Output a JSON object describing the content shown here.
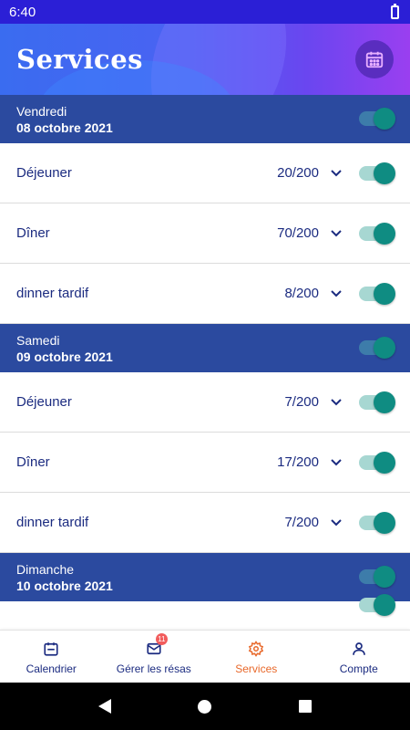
{
  "status_bar": {
    "time": "6:40"
  },
  "header": {
    "title": "Services"
  },
  "days": [
    {
      "name": "Vendredi",
      "date": "08 octobre 2021",
      "enabled": true,
      "services": [
        {
          "name": "Déjeuner",
          "count": "20/200",
          "enabled": true
        },
        {
          "name": "Dîner",
          "count": "70/200",
          "enabled": true
        },
        {
          "name": "dinner tardif",
          "count": "8/200",
          "enabled": true
        }
      ]
    },
    {
      "name": "Samedi",
      "date": "09 octobre 2021",
      "enabled": true,
      "services": [
        {
          "name": "Déjeuner",
          "count": "7/200",
          "enabled": true
        },
        {
          "name": "Dîner",
          "count": "17/200",
          "enabled": true
        },
        {
          "name": "dinner tardif",
          "count": "7/200",
          "enabled": true
        }
      ]
    },
    {
      "name": "Dimanche",
      "date": "10 octobre 2021",
      "enabled": true,
      "services": []
    }
  ],
  "bottom_nav": {
    "items": [
      {
        "label": "Calendrier",
        "icon": "calendar-icon"
      },
      {
        "label": "Gérer les résas",
        "icon": "mail-icon",
        "badge": "11"
      },
      {
        "label": "Services",
        "icon": "gear-icon",
        "active": true
      },
      {
        "label": "Compte",
        "icon": "user-icon"
      }
    ]
  },
  "colors": {
    "status_bar": "#2b1fd6",
    "day_header": "#2b4a9f",
    "text_primary": "#1b2b80",
    "toggle_on": "#0f8c82",
    "nav_active": "#e8682a",
    "badge": "#f25c5c"
  }
}
